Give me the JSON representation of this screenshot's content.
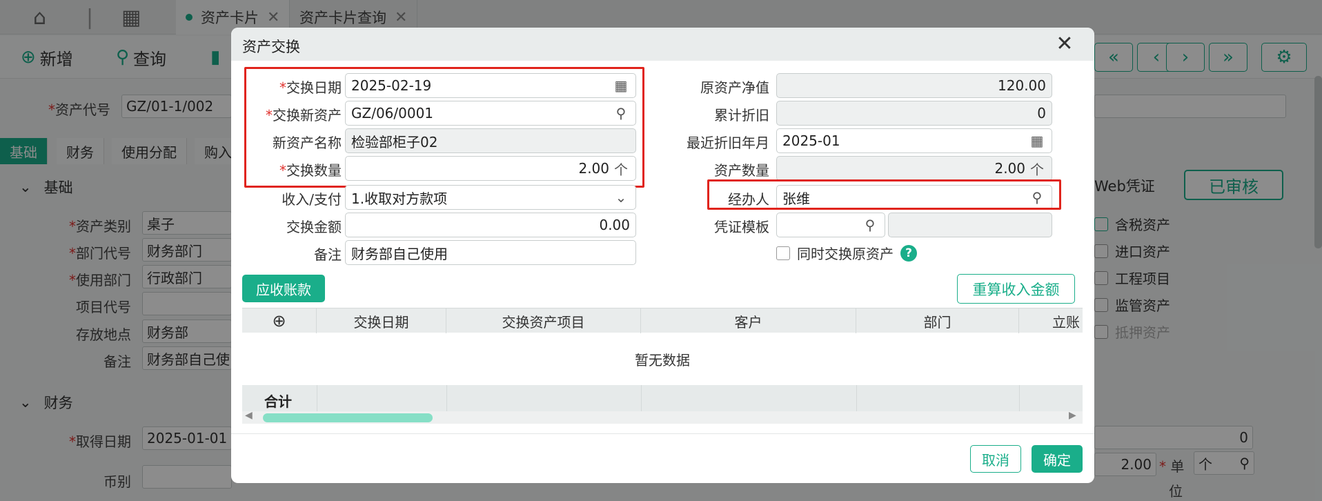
{
  "tabs": [
    {
      "label": "资产卡片",
      "active": true
    },
    {
      "label": "资产卡片查询",
      "active": false
    }
  ],
  "toolbar": {
    "add_label": "新增",
    "query_label": "查询"
  },
  "bg": {
    "asset_code_label": "资产代号",
    "asset_code_value": "GZ/01-1/002",
    "section_tabs": [
      "基础",
      "财务",
      "使用分配",
      "购入"
    ],
    "section_basic": "基础",
    "section_finance": "财务",
    "fields": [
      {
        "label": "资产类别",
        "value": "桌子",
        "required": true
      },
      {
        "label": "部门代号",
        "value": "财务部门",
        "required": true
      },
      {
        "label": "使用部门",
        "value": "行政部门",
        "required": true
      },
      {
        "label": "项目代号",
        "value": "",
        "required": false
      },
      {
        "label": "存放地点",
        "value": "财务部",
        "required": false
      },
      {
        "label": "备注",
        "value": "财务部自己使",
        "required": false
      }
    ],
    "acquire_date_label": "取得日期",
    "acquire_date_value": "2025-01-01",
    "currency_label": "币别",
    "web_voucher": "Web凭证",
    "approved": "已审核",
    "checkboxes": [
      "含税资产",
      "进口资产",
      "工程项目",
      "监管资产",
      "抵押资产"
    ],
    "right_zero": "0",
    "right_qty": "2.00",
    "unit_label_1": "单",
    "unit_label_2": "位",
    "unit_value": "个"
  },
  "dialog": {
    "title": "资产交换",
    "left": {
      "exchange_date_label": "交换日期",
      "exchange_date_value": "2025-02-19",
      "new_asset_label": "交换新资产",
      "new_asset_value": "GZ/06/0001",
      "new_asset_name_label": "新资产名称",
      "new_asset_name_value": "检验部柜子02",
      "exchange_qty_label": "交换数量",
      "exchange_qty_value": "2.00",
      "qty_unit": "个",
      "inout_label": "收入/支付",
      "inout_value": "1.收取对方款项",
      "amount_label": "交换金额",
      "amount_value": "0.00",
      "remark_label": "备注",
      "remark_value": "财务部自己使用"
    },
    "right": {
      "net_value_label": "原资产净值",
      "net_value_value": "120.00",
      "accum_dep_label": "累计折旧",
      "accum_dep_value": "0",
      "last_dep_label": "最近折旧年月",
      "last_dep_value": "2025-01",
      "asset_qty_label": "资产数量",
      "asset_qty_value": "2.00",
      "qty_unit": "个",
      "handler_label": "经办人",
      "handler_value": "张维",
      "voucher_tpl_label": "凭证模板",
      "voucher_tpl_value": "",
      "also_exchange_label": "同时交换原资产"
    },
    "receivable_btn": "应收账款",
    "recalc_btn": "重算收入金额",
    "table": {
      "columns": [
        "交换日期",
        "交换资产项目",
        "客户",
        "部门",
        "立账"
      ],
      "empty_text": "暂无数据",
      "total_label": "合计"
    },
    "cancel_btn": "取消",
    "ok_btn": "确定"
  }
}
